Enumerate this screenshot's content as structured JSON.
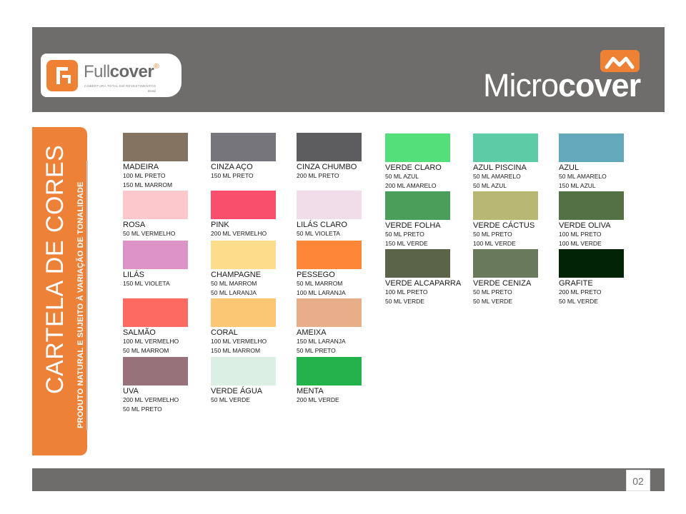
{
  "header": {
    "fullcover": {
      "name_a": "Full",
      "name_b": "cover",
      "reg": "®",
      "tagline": "COBERTURA TOTAL EM REVESTIMENTOS",
      "country": "Brasil"
    },
    "microcover": {
      "name_a": "Micro",
      "name_b": "cover"
    }
  },
  "sidebar": {
    "title": "CARTELA DE CORES",
    "subtitle": "PRODUTO NATURAL E SUJEITO À VARIAÇÃO DE TONALIDADE"
  },
  "colors": [
    {
      "name": "MADEIRA",
      "lines": [
        "100 ML PRETO",
        "150 ML MARROM"
      ],
      "color": "#857362"
    },
    {
      "name": "CINZA AÇO",
      "lines": [
        "150 ML PRETO"
      ],
      "color": "#75757b"
    },
    {
      "name": "CINZA CHUMBO",
      "lines": [
        "200 ML PRETO"
      ],
      "color": "#5d5d5f"
    },
    {
      "name": "VERDE CLARO",
      "lines": [
        "50 ML AZUL",
        "200 ML AMARELO"
      ],
      "color": "#55df7a"
    },
    {
      "name": "AZUL PISCINA",
      "lines": [
        "50 ML AMARELO",
        "50 ML AZUL"
      ],
      "color": "#5dcba6"
    },
    {
      "name": "AZUL",
      "lines": [
        "50 ML AMARELO",
        "150 ML AZUL"
      ],
      "color": "#64a9bb"
    },
    {
      "name": "ROSA",
      "lines": [
        "50 ML VERMELHO"
      ],
      "color": "#fdc8cc"
    },
    {
      "name": "PINK",
      "lines": [
        "200 ML VERMELHO"
      ],
      "color": "#f94f6d"
    },
    {
      "name": "LILÁS CLARO",
      "lines": [
        "50 ML VIOLETA"
      ],
      "color": "#f1dcea"
    },
    {
      "name": "VERDE FOLHA",
      "lines": [
        "50 ML PRETO",
        "150 ML VERDE"
      ],
      "color": "#4b9d5a"
    },
    {
      "name": "VERDE CÁCTUS",
      "lines": [
        "50 ML PRETO",
        "100 ML VERDE"
      ],
      "color": "#b9b774"
    },
    {
      "name": "VERDE OLIVA",
      "lines": [
        "100 ML PRETO",
        "100 ML VERDE"
      ],
      "color": "#547145"
    },
    {
      "name": "LILÁS",
      "lines": [
        "150 ML VIOLETA"
      ],
      "color": "#dc93c7"
    },
    {
      "name": "CHAMPAGNE",
      "lines": [
        "50 ML MARROM",
        "50 ML LARANJA"
      ],
      "color": "#fddd8c"
    },
    {
      "name": "PESSEGO",
      "lines": [
        "50 ML MARROM",
        "100 ML LARANJA"
      ],
      "color": "#fd8639"
    },
    {
      "name": "VERDE ALCAPARRA",
      "lines": [
        "100 ML PRETO",
        "50 ML VERDE"
      ],
      "color": "#5a6449"
    },
    {
      "name": "VERDE CENIZA",
      "lines": [
        "50 ML PRETO",
        "50 ML VERDE"
      ],
      "color": "#687a5b"
    },
    {
      "name": "GRAFITE",
      "lines": [
        "200 ML PRETO",
        "50 ML VERDE"
      ],
      "color": "#022306"
    },
    {
      "name": "SALMÃO",
      "lines": [
        "100 ML VERMELHO",
        "50 ML MARROM"
      ],
      "color": "#fd6a61"
    },
    {
      "name": "CORAL",
      "lines": [
        "100 ML VERMELHO",
        "150 ML MARROM"
      ],
      "color": "#fcc775"
    },
    {
      "name": "AMEIXA",
      "lines": [
        "150 ML LARANJA",
        "50 ML PRETO"
      ],
      "color": "#e8ae89"
    },
    {
      "name": "UVA",
      "lines": [
        "200 ML VERMELHO",
        "50 ML PRETO"
      ],
      "color": "#97727a"
    },
    {
      "name": "VERDE ÁGUA",
      "lines": [
        "50 ML VERDE"
      ],
      "color": "#dcefe4"
    },
    {
      "name": "MENTA",
      "lines": [
        "200 ML VERDE"
      ],
      "color": "#23b24c"
    }
  ],
  "footer": {
    "page": "02"
  }
}
